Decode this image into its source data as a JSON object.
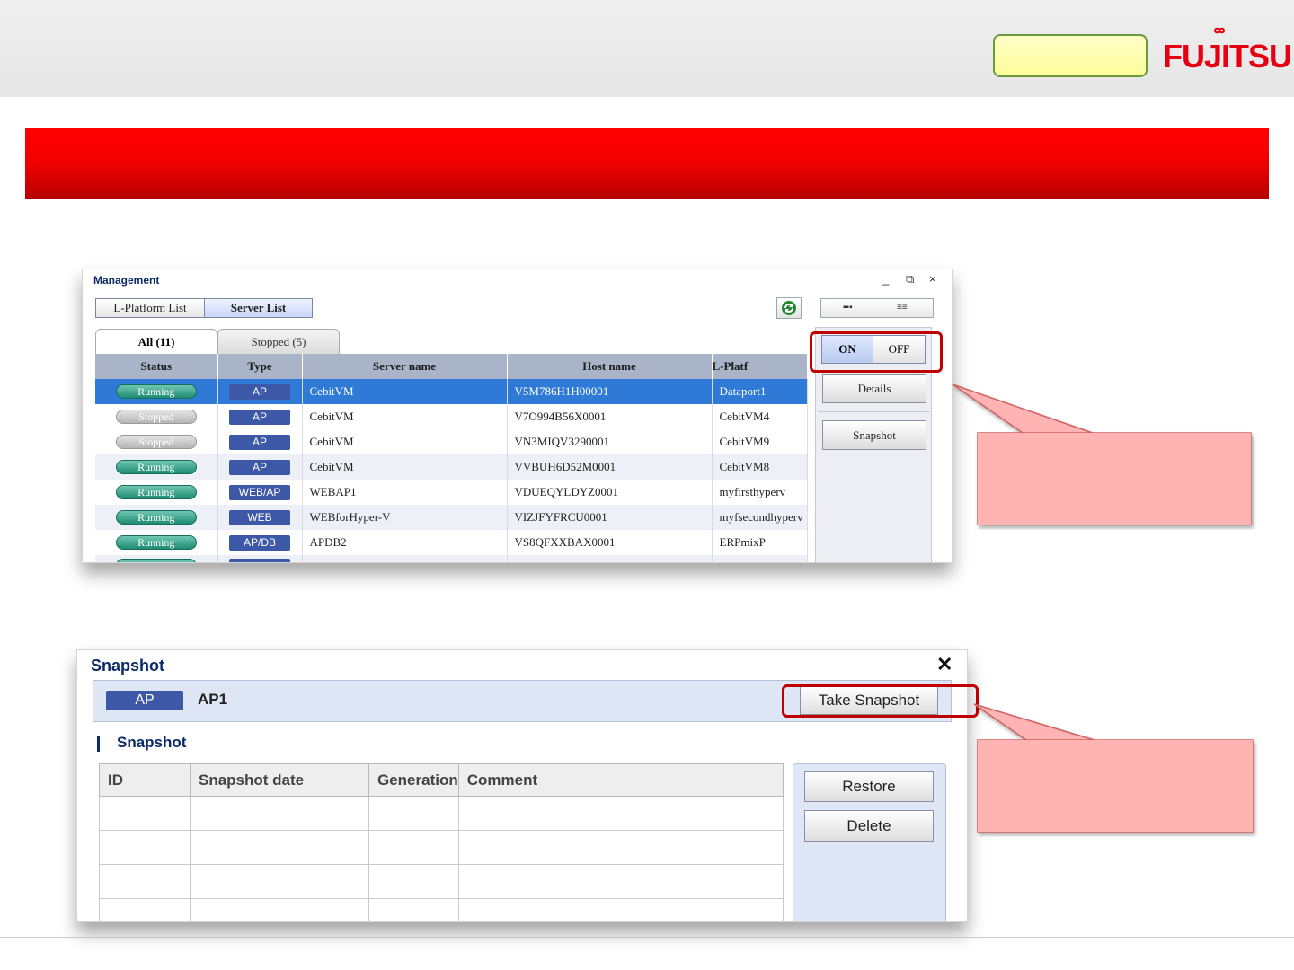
{
  "brand": {
    "logo_text": "FUJITSU"
  },
  "management": {
    "title": "Management",
    "controls": {
      "minimize": "_",
      "restore": "⧉",
      "close": "×"
    },
    "view_tabs": [
      "L-Platform List",
      "Server List"
    ],
    "view_switch": {
      "left": "▪▪▪",
      "right": "≡≡"
    },
    "filter_tabs": [
      "All (11)",
      "Stopped (5)"
    ],
    "columns": [
      "Status",
      "Type",
      "Server name",
      "Host name",
      "L-Platf"
    ],
    "rows": [
      {
        "status": "Running",
        "type": "AP",
        "server": "CebitVM",
        "host": "V5M786H1H00001",
        "lplat": "Dataport1"
      },
      {
        "status": "Stopped",
        "type": "AP",
        "server": "CebitVM",
        "host": "V7O994B56X0001",
        "lplat": "CebitVM4"
      },
      {
        "status": "Stopped",
        "type": "AP",
        "server": "CebitVM",
        "host": "VN3MIQV3290001",
        "lplat": "CebitVM9"
      },
      {
        "status": "Running",
        "type": "AP",
        "server": "CebitVM",
        "host": "VVBUH6D52M0001",
        "lplat": "CebitVM8"
      },
      {
        "status": "Running",
        "type": "WEB/AP",
        "server": "WEBAP1",
        "host": "VDUEQYLDYZ0001",
        "lplat": "myfirsthyperv"
      },
      {
        "status": "Running",
        "type": "WEB",
        "server": "WEBforHyper-V",
        "host": "VIZJFYFRCU0001",
        "lplat": "myfsecondhyperv"
      },
      {
        "status": "Running",
        "type": "AP/DB",
        "server": "APDB2",
        "host": "VS8QFXXBAX0001",
        "lplat": "ERPmixP"
      }
    ],
    "power": {
      "on": "ON",
      "off": "OFF"
    },
    "details_label": "Details",
    "snapshot_label": "Snapshot"
  },
  "snapshot_dialog": {
    "title": "Snapshot",
    "close": "✕",
    "type_badge": "AP",
    "server_name": "AP1",
    "take_snapshot": "Take Snapshot",
    "section_title": "Snapshot",
    "columns": [
      "ID",
      "Snapshot date",
      "Generation",
      "Comment"
    ],
    "restore_label": "Restore",
    "delete_label": "Delete"
  },
  "colors": {
    "accent_red": "#e60012",
    "banner_red": "#ff0000",
    "selection_blue": "#2f7ad6",
    "type_badge": "#3c58a6",
    "callout_fill": "#ffb3b3"
  }
}
